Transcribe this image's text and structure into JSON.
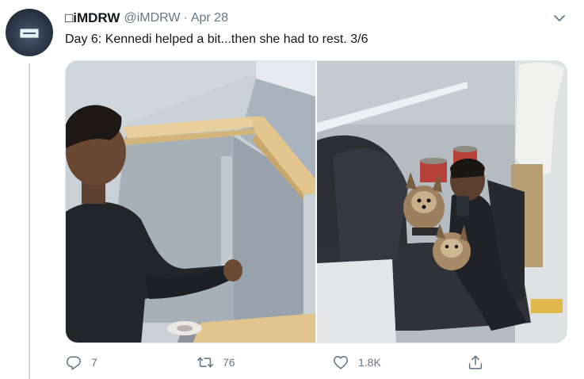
{
  "tweet": {
    "display_name": "□iMDRW",
    "handle": "@iMDRW",
    "separator": "·",
    "date": "Apr 28",
    "text": "Day 6: Kennedi helped a bit...then she had to rest. 3/6"
  },
  "actions": {
    "reply_count": "7",
    "retweet_count": "76",
    "like_count": "1.8K"
  },
  "icons": {
    "reply": "reply-icon",
    "retweet": "retweet-icon",
    "like": "heart-icon",
    "share": "share-icon",
    "caret": "chevron-down-icon"
  },
  "colors": {
    "text": "#14171a",
    "secondary": "#657786",
    "border": "#e1e8ed"
  }
}
